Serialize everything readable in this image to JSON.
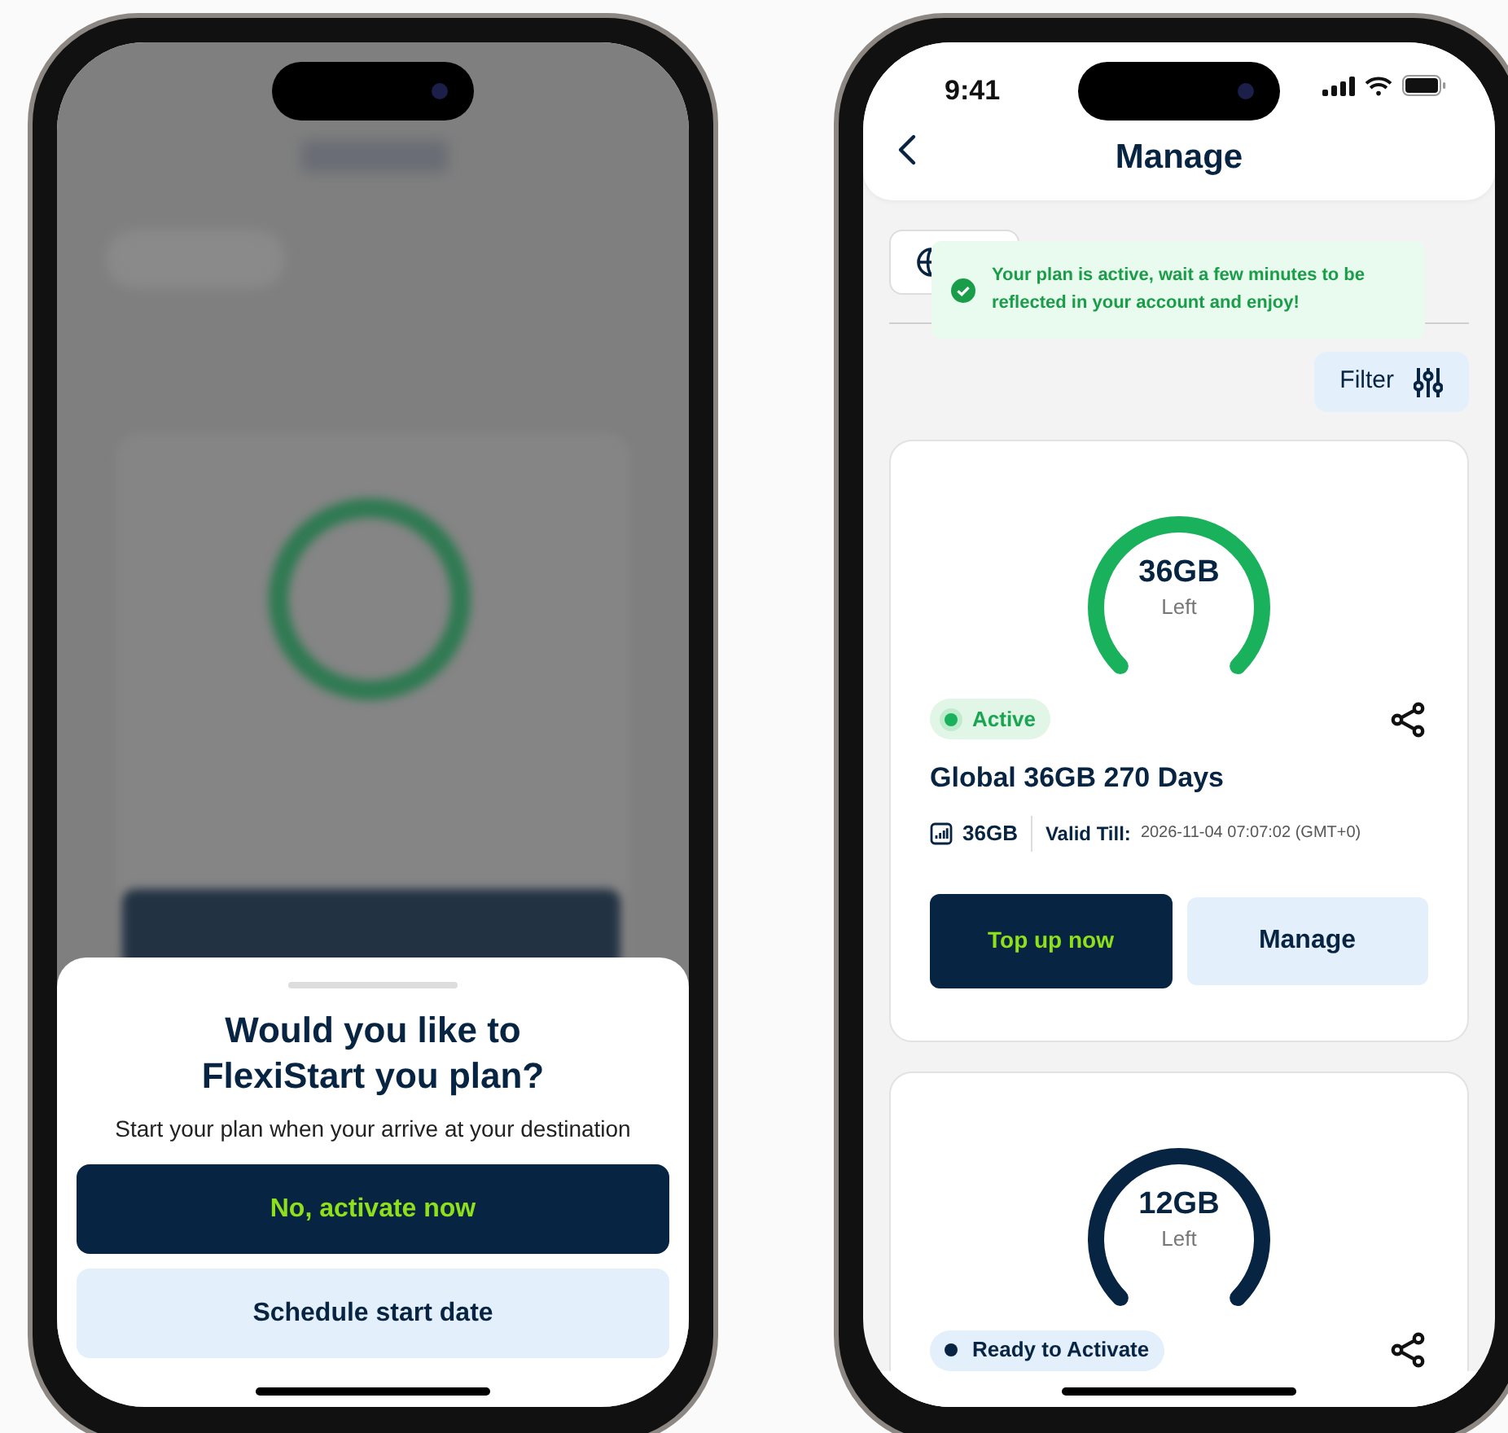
{
  "left_phone": {
    "sheet": {
      "title_lines": [
        "Would you like to",
        "FlexiStart you plan?"
      ],
      "subtitle": "Start your plan when your arrive at your destination",
      "buttons": [
        {
          "label": "No, activate now",
          "kind": "primary"
        },
        {
          "label": "Schedule start date",
          "kind": "secondary"
        }
      ]
    }
  },
  "right_phone": {
    "status_bar": {
      "time": "9:41"
    },
    "header": {
      "title": "Manage"
    },
    "toast": {
      "message": "Your plan is active, wait a few minutes to be reflected in your account and enjoy!"
    },
    "filter": {
      "label": "Filter"
    },
    "plans": [
      {
        "kind": "active",
        "amount": "36GB",
        "amount_caption": "Left",
        "status": "Active",
        "name": "Global 36GB 270 Days",
        "data": "36GB",
        "valid_label": "Valid Till:",
        "valid_value": "2026-11-04 07:07:02 (GMT+0)",
        "buttons": [
          {
            "label": "Top up now",
            "kind": "primary"
          },
          {
            "label": "Manage",
            "kind": "secondary"
          }
        ]
      },
      {
        "kind": "ready",
        "amount": "12GB",
        "amount_caption": "Left",
        "status": "Ready to Activate"
      }
    ]
  }
}
